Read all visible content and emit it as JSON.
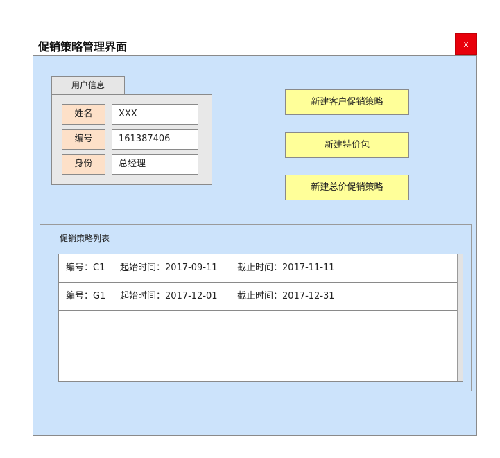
{
  "window": {
    "title": "促销策略管理界面",
    "close_label": "x"
  },
  "user_info": {
    "tab_label": "用户信息",
    "fields": [
      {
        "label": "姓名",
        "value": "XXX"
      },
      {
        "label": "编号",
        "value": "161387406"
      },
      {
        "label": "身份",
        "value": "总经理"
      }
    ]
  },
  "actions": [
    {
      "label": "新建客户促销策略"
    },
    {
      "label": "新建特价包"
    },
    {
      "label": "新建总价促销策略"
    }
  ],
  "strategy_list": {
    "title": "促销策略列表",
    "rows": [
      {
        "id": "编号：C1",
        "start": "起始时间：2017-09-11",
        "end": "截止时间：2017-11-11"
      },
      {
        "id": "编号：G1",
        "start": "起始时间：2017-12-01",
        "end": "截止时间：2017-12-31"
      }
    ]
  },
  "colors": {
    "window_bg": "#cce3fb",
    "close_button": "#e8000b",
    "action_button": "#ffff99",
    "field_label_bg": "#fde0c8"
  }
}
